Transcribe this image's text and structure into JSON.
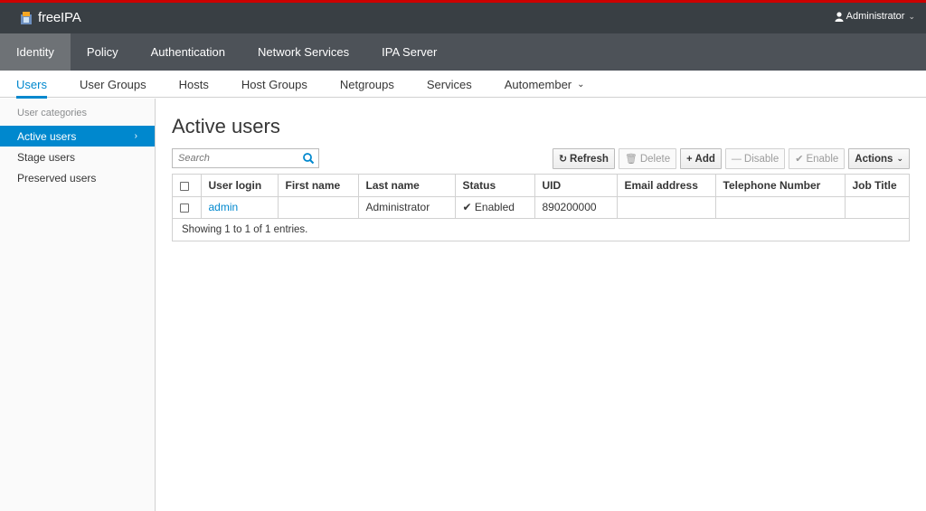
{
  "brand": {
    "name": "freeIPA"
  },
  "user_menu": {
    "label": "Administrator"
  },
  "primary_nav": [
    "Identity",
    "Policy",
    "Authentication",
    "Network Services",
    "IPA Server"
  ],
  "secondary_nav": [
    "Users",
    "User Groups",
    "Hosts",
    "Host Groups",
    "Netgroups",
    "Services",
    "Automember"
  ],
  "sidebar": {
    "heading": "User categories",
    "items": [
      "Active users",
      "Stage users",
      "Preserved users"
    ]
  },
  "main": {
    "title": "Active users",
    "search_placeholder": "Search"
  },
  "toolbar": {
    "refresh": "Refresh",
    "delete": "Delete",
    "add": "Add",
    "disable": "Disable",
    "enable": "Enable",
    "actions": "Actions"
  },
  "table": {
    "columns": [
      "User login",
      "First name",
      "Last name",
      "Status",
      "UID",
      "Email address",
      "Telephone Number",
      "Job Title"
    ],
    "rows": [
      {
        "login": "admin",
        "first": "",
        "last": "Administrator",
        "status": "Enabled",
        "uid": "890200000",
        "email": "",
        "phone": "",
        "job": ""
      }
    ],
    "footer": "Showing 1 to 1 of 1 entries."
  },
  "colors": {
    "accent": "#0088ce",
    "topbar": "#393f44",
    "nav": "#4d5258",
    "nav_active": "#6e7276"
  },
  "icons": [
    "brand-logo-icon",
    "user-icon",
    "search-icon",
    "refresh-icon",
    "trash-icon",
    "plus-icon",
    "minus-icon",
    "check-icon",
    "chevron-down-icon",
    "chevron-right-icon"
  ]
}
